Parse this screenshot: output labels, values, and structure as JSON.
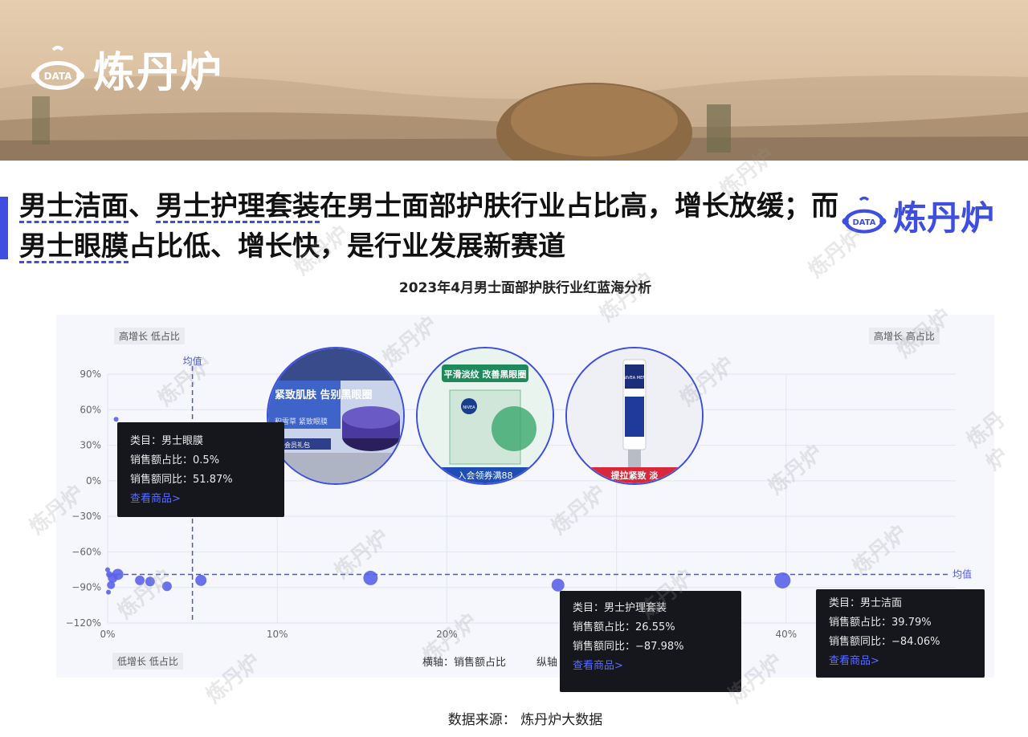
{
  "brand": {
    "name": "炼丹炉",
    "badge": "DATA"
  },
  "headline": {
    "part1_hl": "男士洁面",
    "part2": "、",
    "part3_hl": "男士护理套装",
    "part4": "在男士面部护肤行业占比高，增长放缓；而",
    "part5_hl": "男士眼膜",
    "part6": "占比低、增长快，是行业发展新赛道"
  },
  "chart_data": {
    "type": "scatter",
    "title": "2023年4月男士面部护肤行业红蓝海分析",
    "xlabel": "横轴：销售额占比",
    "ylabel_partial": "纵轴",
    "xlim": [
      0,
      50
    ],
    "ylim": [
      -120,
      90
    ],
    "x_ticks": [
      "0%",
      "10%",
      "20%",
      "30%",
      "40%"
    ],
    "x_tick_values": [
      0,
      10,
      20,
      30,
      40
    ],
    "y_ticks": [
      "90%",
      "60%",
      "30%",
      "0%",
      "−30%",
      "−60%",
      "−90%",
      "−120%"
    ],
    "y_tick_values": [
      90,
      60,
      30,
      0,
      -30,
      -60,
      -90,
      -120
    ],
    "mean_label": "均值",
    "mean_x": 5.0,
    "mean_y": -79,
    "quadrants": {
      "top_left": "高增长 低占比",
      "top_right": "高增长 高占比",
      "bottom_left": "低增长 低占比"
    },
    "points": [
      {
        "x": 0.5,
        "y": 51.87,
        "r": 3
      },
      {
        "x": 26.55,
        "y": -87.98,
        "r": 8
      },
      {
        "x": 39.79,
        "y": -84.06,
        "r": 10
      },
      {
        "x": 15.5,
        "y": -82,
        "r": 9
      },
      {
        "x": 5.5,
        "y": -84,
        "r": 7
      },
      {
        "x": 3.5,
        "y": -89,
        "r": 6
      },
      {
        "x": 2.5,
        "y": -85,
        "r": 6
      },
      {
        "x": 1.9,
        "y": -84,
        "r": 6
      },
      {
        "x": 0.6,
        "y": -79,
        "r": 7
      },
      {
        "x": 0.3,
        "y": -82,
        "r": 6
      },
      {
        "x": 0.2,
        "y": -88,
        "r": 5
      },
      {
        "x": 0.1,
        "y": -79,
        "r": 4
      },
      {
        "x": 0.05,
        "y": -94,
        "r": 3
      },
      {
        "x": 0.0,
        "y": -75,
        "r": 3
      }
    ],
    "color": "#5a63e8"
  },
  "tooltips": {
    "eye_mask": {
      "category_label": "类目：",
      "category": "男士眼膜",
      "share_label": "销售额占比：",
      "share": "0.5%",
      "yoy_label": "销售额同比：",
      "yoy": "51.87%",
      "link": "查看商品>"
    },
    "care_set": {
      "category_label": "类目：",
      "category": "男士护理套装",
      "share_label": "销售额占比：",
      "share": "26.55%",
      "yoy_label": "销售额同比：",
      "yoy": "−87.98%",
      "link": "查看商品>"
    },
    "cleanser": {
      "category_label": "类目：",
      "category": "男士洁面",
      "share_label": "销售额占比：",
      "share": "39.79%",
      "yoy_label": "销售额同比：",
      "yoy": "−84.06%",
      "link": "查看商品>"
    }
  },
  "products": {
    "p1": {
      "badge": "紧致肌肤 告别黑眼圈",
      "sub": "积雪草 紧致眼膜",
      "gift": "新会员礼包",
      "bottom": ""
    },
    "p2": {
      "badge": "平滑淡纹 改善黑眼圈",
      "brand": "NIVEA",
      "bottom": "入会领券满88"
    },
    "p3": {
      "brand": "NIVEA MEN",
      "bottom": "提拉紧致 淡"
    }
  },
  "watermark": "炼丹炉",
  "source": "数据来源：   炼丹炉大数据"
}
